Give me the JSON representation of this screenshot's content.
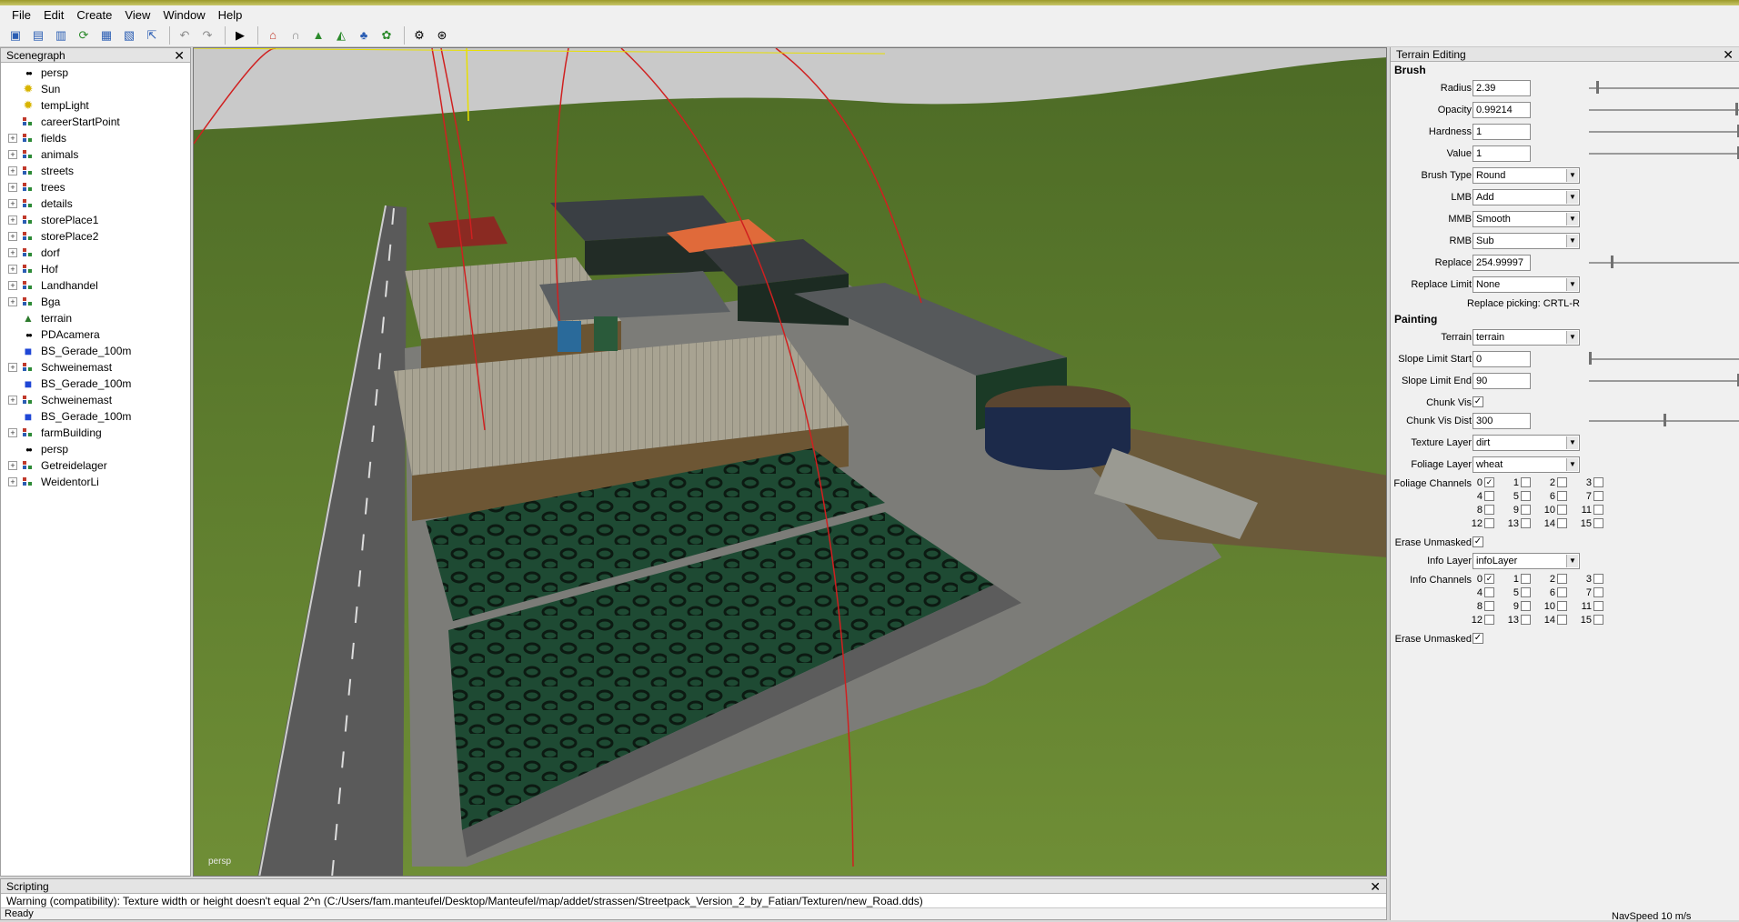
{
  "menu": [
    "File",
    "Edit",
    "Create",
    "View",
    "Window",
    "Help"
  ],
  "toolbar_icons": [
    "new-icon",
    "open-icon",
    "import-icon",
    "refresh-icon",
    "save-icon",
    "save-as-icon",
    "export-icon",
    "undo-icon",
    "redo-icon",
    "play-icon",
    "home-icon",
    "magnet-icon",
    "terrain-tool-icon",
    "terrain-paint-icon",
    "foliage-icon",
    "grass-icon",
    "camera-settings-icon",
    "camera-target-icon"
  ],
  "scenegraph": {
    "title": "Scenegraph",
    "items": [
      {
        "label": "persp",
        "icon": "camera",
        "expandable": false
      },
      {
        "label": "Sun",
        "icon": "light",
        "expandable": false
      },
      {
        "label": "tempLight",
        "icon": "light",
        "expandable": false
      },
      {
        "label": "careerStartPoint",
        "icon": "transform",
        "expandable": false
      },
      {
        "label": "fields",
        "icon": "transform",
        "expandable": true
      },
      {
        "label": "animals",
        "icon": "transform",
        "expandable": true
      },
      {
        "label": "streets",
        "icon": "transform",
        "expandable": true
      },
      {
        "label": "trees",
        "icon": "transform",
        "expandable": true
      },
      {
        "label": "details",
        "icon": "transform",
        "expandable": true
      },
      {
        "label": "storePlace1",
        "icon": "transform",
        "expandable": true
      },
      {
        "label": "storePlace2",
        "icon": "transform",
        "expandable": true
      },
      {
        "label": "dorf",
        "icon": "transform",
        "expandable": true
      },
      {
        "label": "Hof",
        "icon": "transform",
        "expandable": true
      },
      {
        "label": "Landhandel",
        "icon": "transform",
        "expandable": true
      },
      {
        "label": "Bga",
        "icon": "transform",
        "expandable": true
      },
      {
        "label": "terrain",
        "icon": "terrain",
        "expandable": false
      },
      {
        "label": "PDAcamera",
        "icon": "camera",
        "expandable": false
      },
      {
        "label": "BS_Gerade_100m",
        "icon": "cube",
        "expandable": false
      },
      {
        "label": "Schweinemast",
        "icon": "transform",
        "expandable": true
      },
      {
        "label": "BS_Gerade_100m",
        "icon": "cube",
        "expandable": false
      },
      {
        "label": "Schweinemast",
        "icon": "transform",
        "expandable": true
      },
      {
        "label": "BS_Gerade_100m",
        "icon": "cube",
        "expandable": false
      },
      {
        "label": "farmBuilding",
        "icon": "transform",
        "expandable": true
      },
      {
        "label": "persp",
        "icon": "camera",
        "expandable": false
      },
      {
        "label": "Getreidelager",
        "icon": "transform",
        "expandable": true
      },
      {
        "label": "WeidentorLi",
        "icon": "transform",
        "expandable": true
      }
    ]
  },
  "viewport": {
    "camera_label": "persp"
  },
  "terrain": {
    "title": "Terrain Editing",
    "brush_head": "Brush",
    "radius_label": "Radius",
    "radius": "2.39",
    "radius_level": 0.05,
    "opacity_label": "Opacity",
    "opacity": "0.99214",
    "opacity_level": 0.99,
    "hardness_label": "Hardness",
    "hardness": "1",
    "hardness_level": 1.0,
    "value_label": "Value",
    "value": "1",
    "value_level": 1.0,
    "brush_type_label": "Brush Type",
    "brush_type": "Round",
    "lmb_label": "LMB",
    "lmb": "Add",
    "mmb_label": "MMB",
    "mmb": "Smooth",
    "rmb_label": "RMB",
    "rmb": "Sub",
    "replace_label": "Replace",
    "replace": "254.99997",
    "replace_level": 0.15,
    "replace_limit_label": "Replace Limit",
    "replace_limit": "None",
    "replace_picking": "Replace picking: CRTL-R",
    "painting_head": "Painting",
    "terrain_label": "Terrain",
    "terrain_value": "terrain",
    "slope_start_label": "Slope Limit Start",
    "slope_start": "0",
    "slope_start_level": 0.0,
    "slope_end_label": "Slope Limit End",
    "slope_end": "90",
    "slope_end_level": 1.0,
    "chunk_vis_label": "Chunk Vis",
    "chunk_vis": true,
    "chunk_vis_dist_label": "Chunk Vis Dist",
    "chunk_vis_dist": "300",
    "chunk_vis_dist_level": 0.5,
    "texture_layer_label": "Texture Layer",
    "texture_layer": "dirt",
    "foliage_layer_label": "Foliage Layer",
    "foliage_layer": "wheat",
    "foliage_channels_label": "Foliage Channels",
    "foliage_checked": [
      0
    ],
    "erase_unmasked_label": "Erase Unmasked",
    "erase_unmasked_1": true,
    "info_layer_label": "Info Layer",
    "info_layer": "infoLayer",
    "info_channels_label": "Info Channels",
    "info_checked": [
      0
    ],
    "erase_unmasked_2": true,
    "channel_numbers": [
      "0",
      "1",
      "2",
      "3",
      "4",
      "5",
      "6",
      "7",
      "8",
      "9",
      "10",
      "11",
      "12",
      "13",
      "14",
      "15"
    ]
  },
  "scripting": {
    "title": "Scripting",
    "message": "Warning (compatibility): Texture width or height doesn't equal 2^n (C:/Users/fam.manteufel/Desktop/Manteufel/map/addet/strassen/Streetpack_Version_2_by_Fatian/Texturen/new_Road.dds)",
    "status_left": "Ready",
    "status_right": "NavSpeed 10 m/s"
  }
}
